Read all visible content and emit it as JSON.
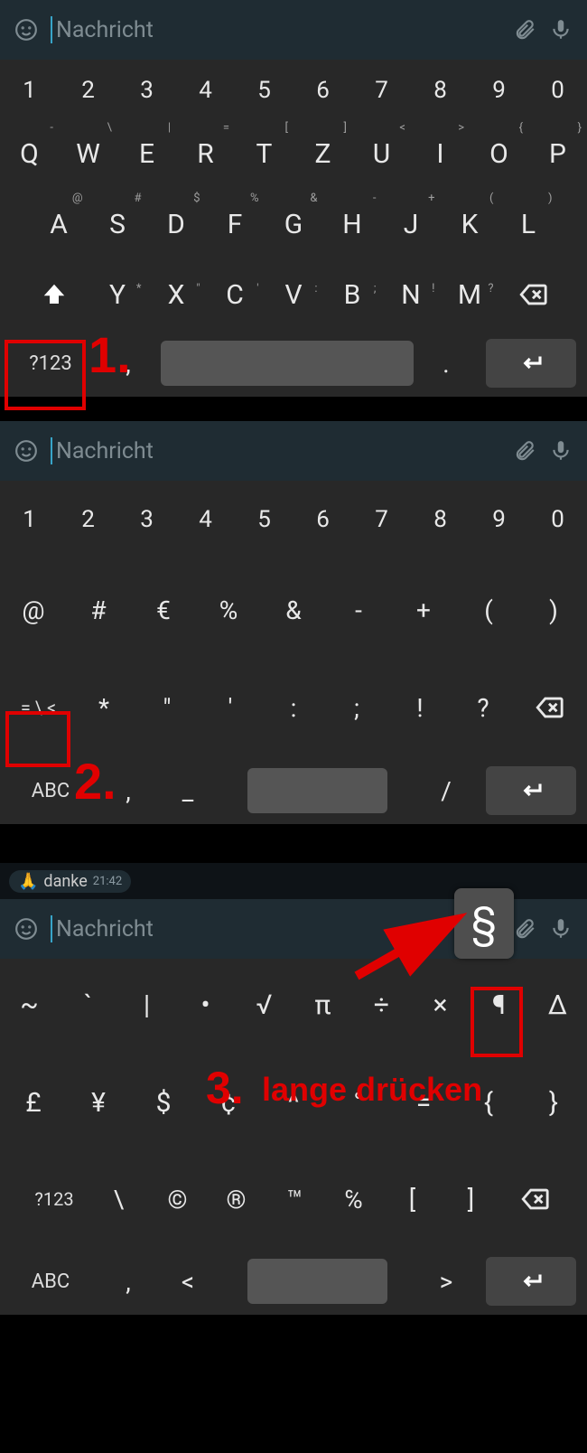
{
  "input": {
    "placeholder": "Nachricht"
  },
  "chat": {
    "text": "danke",
    "time": "21:42",
    "emoji": "🙏"
  },
  "popup": {
    "char": "§"
  },
  "annotations": {
    "step1": "1.",
    "step2": "2.",
    "step3": "3.",
    "step3_text": "lange drücken"
  },
  "kbd1": {
    "numbers": [
      "1",
      "2",
      "3",
      "4",
      "5",
      "6",
      "7",
      "8",
      "9",
      "0"
    ],
    "row1": [
      "Q",
      "W",
      "E",
      "R",
      "T",
      "Z",
      "U",
      "I",
      "O",
      "P"
    ],
    "row1_hints": [
      "-",
      "\\",
      "|",
      "=",
      "[",
      "]",
      "<",
      ">",
      "{",
      "}"
    ],
    "row2": [
      "A",
      "S",
      "D",
      "F",
      "G",
      "H",
      "J",
      "K",
      "L"
    ],
    "row2_hints": [
      "@",
      "#",
      "$",
      "%",
      "&",
      "-",
      "+",
      "(",
      ")"
    ],
    "row3": [
      "Y",
      "X",
      "C",
      "V",
      "B",
      "N",
      "M"
    ],
    "row3_hints": [
      "*",
      "\"",
      "'",
      ":",
      ";",
      "!",
      "?"
    ],
    "mode": "?123",
    "comma": ",",
    "dot": "."
  },
  "kbd2": {
    "numbers": [
      "1",
      "2",
      "3",
      "4",
      "5",
      "6",
      "7",
      "8",
      "9",
      "0"
    ],
    "row_sym1": [
      "@",
      "#",
      "€",
      "%",
      "&",
      "-",
      "+",
      "(",
      ")"
    ],
    "row_sym2": [
      "*",
      "\"",
      "'",
      ":",
      ";",
      "!",
      "?"
    ],
    "shift_mode": "= \\ <",
    "mode": "ABC",
    "comma": ",",
    "under": "_",
    "slash": "/"
  },
  "kbd3": {
    "row1": [
      "~",
      "`",
      "|",
      "•",
      "√",
      "π",
      "÷",
      "×",
      "¶",
      "Δ"
    ],
    "row2": [
      "£",
      "¥",
      "$",
      "¢",
      "^",
      "°",
      "=",
      "{",
      "}"
    ],
    "row3": [
      "\\",
      "©",
      "®",
      "™",
      "℅",
      "[",
      "]"
    ],
    "shift_mode": "?123",
    "mode": "ABC",
    "comma": ",",
    "lt": "<",
    "gt": ">"
  }
}
